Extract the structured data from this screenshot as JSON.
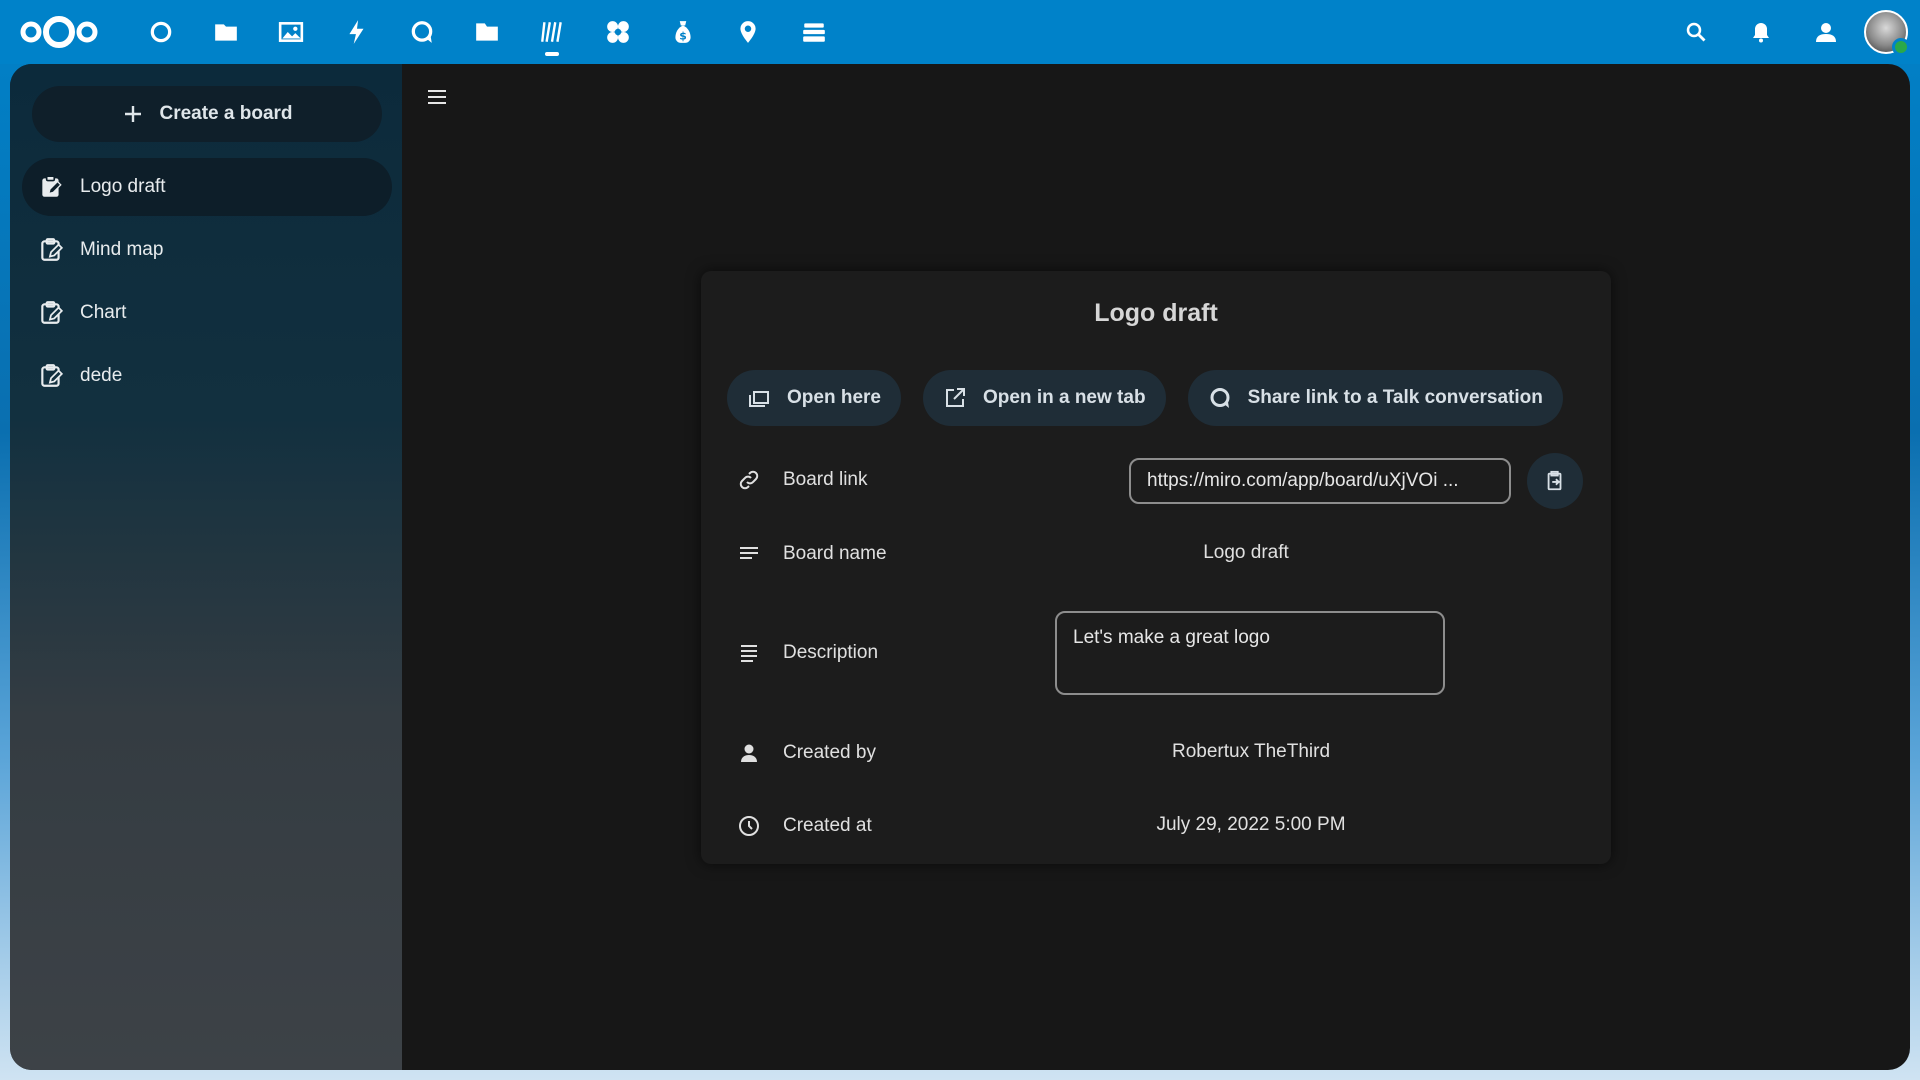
{
  "header": {
    "apps": [
      {
        "name": "dashboard-icon"
      },
      {
        "name": "files-icon"
      },
      {
        "name": "photos-icon"
      },
      {
        "name": "activity-icon"
      },
      {
        "name": "talk-icon"
      },
      {
        "name": "folder-icon"
      },
      {
        "name": "whiteboard-icon",
        "active": true
      },
      {
        "name": "apps-icon"
      },
      {
        "name": "cospend-icon"
      },
      {
        "name": "maps-icon"
      },
      {
        "name": "deck-icon"
      }
    ],
    "right_icons": [
      "search-icon",
      "notifications-icon",
      "contacts-icon"
    ]
  },
  "sidebar": {
    "create_label": "Create a board",
    "items": [
      {
        "label": "Logo draft",
        "active": true
      },
      {
        "label": "Mind map"
      },
      {
        "label": "Chart"
      },
      {
        "label": "dede"
      }
    ]
  },
  "board": {
    "title": "Logo draft",
    "actions": {
      "open_here": "Open here",
      "open_new_tab": "Open in a new tab",
      "share_talk": "Share link to a Talk conversation"
    },
    "fields": {
      "link_label": "Board link",
      "link_value": "https://miro.com/app/board/uXjVOi  ...",
      "name_label": "Board name",
      "name_value": "Logo draft",
      "description_label": "Description",
      "description_value": "Let's make a great logo",
      "created_by_label": "Created by",
      "created_by_value": "Robertux TheThird",
      "created_at_label": "Created at",
      "created_at_value": "July 29, 2022 5:00 PM"
    }
  },
  "colors": {
    "header": "#0082c9",
    "panel": "#1c1c1c",
    "button_bg": "#1f2d37"
  }
}
